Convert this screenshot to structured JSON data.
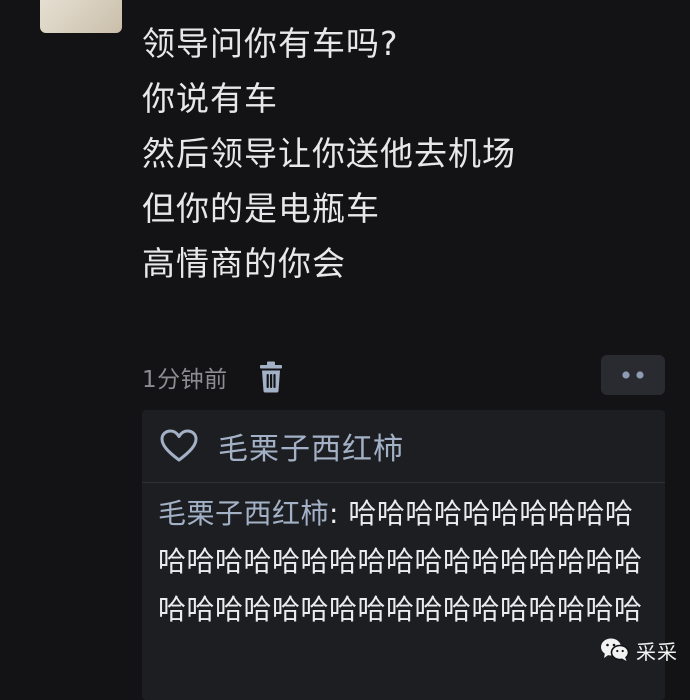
{
  "post": {
    "lines": [
      "领导问你有车吗?",
      "你说有车",
      "然后领导让你送他去机场",
      "但你的是电瓶车",
      "高情商的你会"
    ]
  },
  "meta": {
    "timestamp": "1分钟前",
    "delete_icon": "trash-icon",
    "more_icon": "more-dots-icon"
  },
  "likes": {
    "icon": "heart-icon",
    "names": "毛栗子西红柿"
  },
  "comments": [
    {
      "author": "毛栗子西红柿",
      "separator": ": ",
      "text": "哈哈哈哈哈哈哈哈哈哈哈哈哈哈哈哈哈哈哈哈哈哈哈哈哈哈哈哈哈哈哈哈哈哈哈哈哈哈哈哈哈哈哈哈"
    }
  ],
  "watermark": {
    "icon": "wechat-icon",
    "text": "采采"
  },
  "colors": {
    "background": "#131316",
    "post_text": "#e8e8ea",
    "meta_text": "#8c8c93",
    "author_link": "#a3b1c7",
    "comment_box": "#1d1e22"
  }
}
